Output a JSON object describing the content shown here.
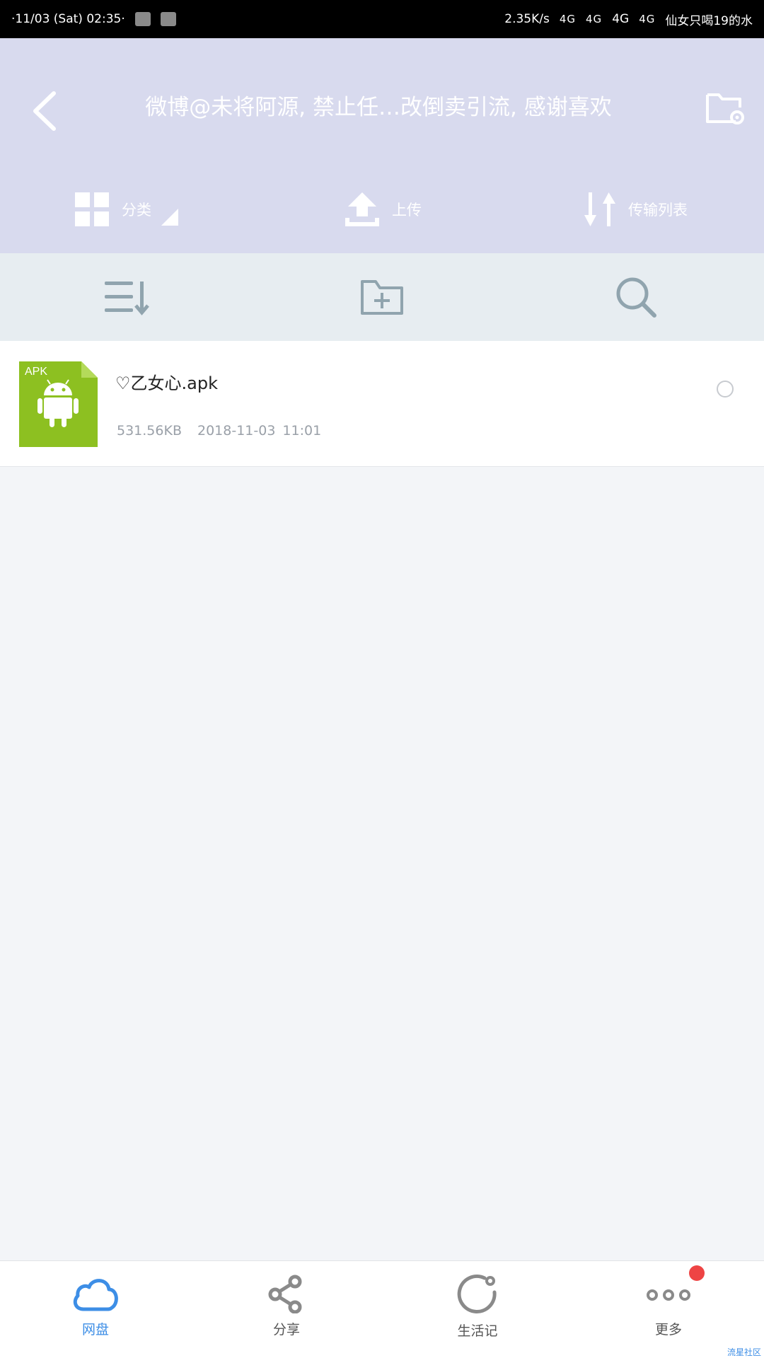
{
  "status_bar": {
    "datetime": "·11/03 (Sat) 02:35·",
    "speed": "2.35K/s",
    "signal_glyphs": [
      "4G",
      "4G",
      "4G"
    ],
    "network": "4G",
    "carrier_text": "仙女只喝19的水"
  },
  "header": {
    "title": "微博@未将阿源, 禁止任…改倒卖引流, 感谢喜欢",
    "actions": {
      "category_label": "分类",
      "upload_label": "上传",
      "transfer_label": "传输列表"
    }
  },
  "toolbar": {
    "icons": [
      "sort-icon",
      "new-folder-icon",
      "search-icon"
    ]
  },
  "files": [
    {
      "badge": "APK",
      "name": "♡乙女心.apk",
      "size": "531.56KB",
      "date": "2018-11-03",
      "time": "11:01"
    }
  ],
  "bottom_nav": {
    "items": [
      {
        "label": "网盘",
        "icon": "cloud-icon",
        "active": true
      },
      {
        "label": "分享",
        "icon": "share-icon",
        "active": false
      },
      {
        "label": "生活记",
        "icon": "life-icon",
        "active": false
      },
      {
        "label": "更多",
        "icon": "more-icon",
        "active": false
      }
    ],
    "watermark": "流星社区"
  },
  "colors": {
    "header_bg": "#d8daee",
    "toolbar_bg": "#e7edf1",
    "accent": "#3d8ee6",
    "apk_green": "#8dc021",
    "badge_red": "#ee4444"
  }
}
